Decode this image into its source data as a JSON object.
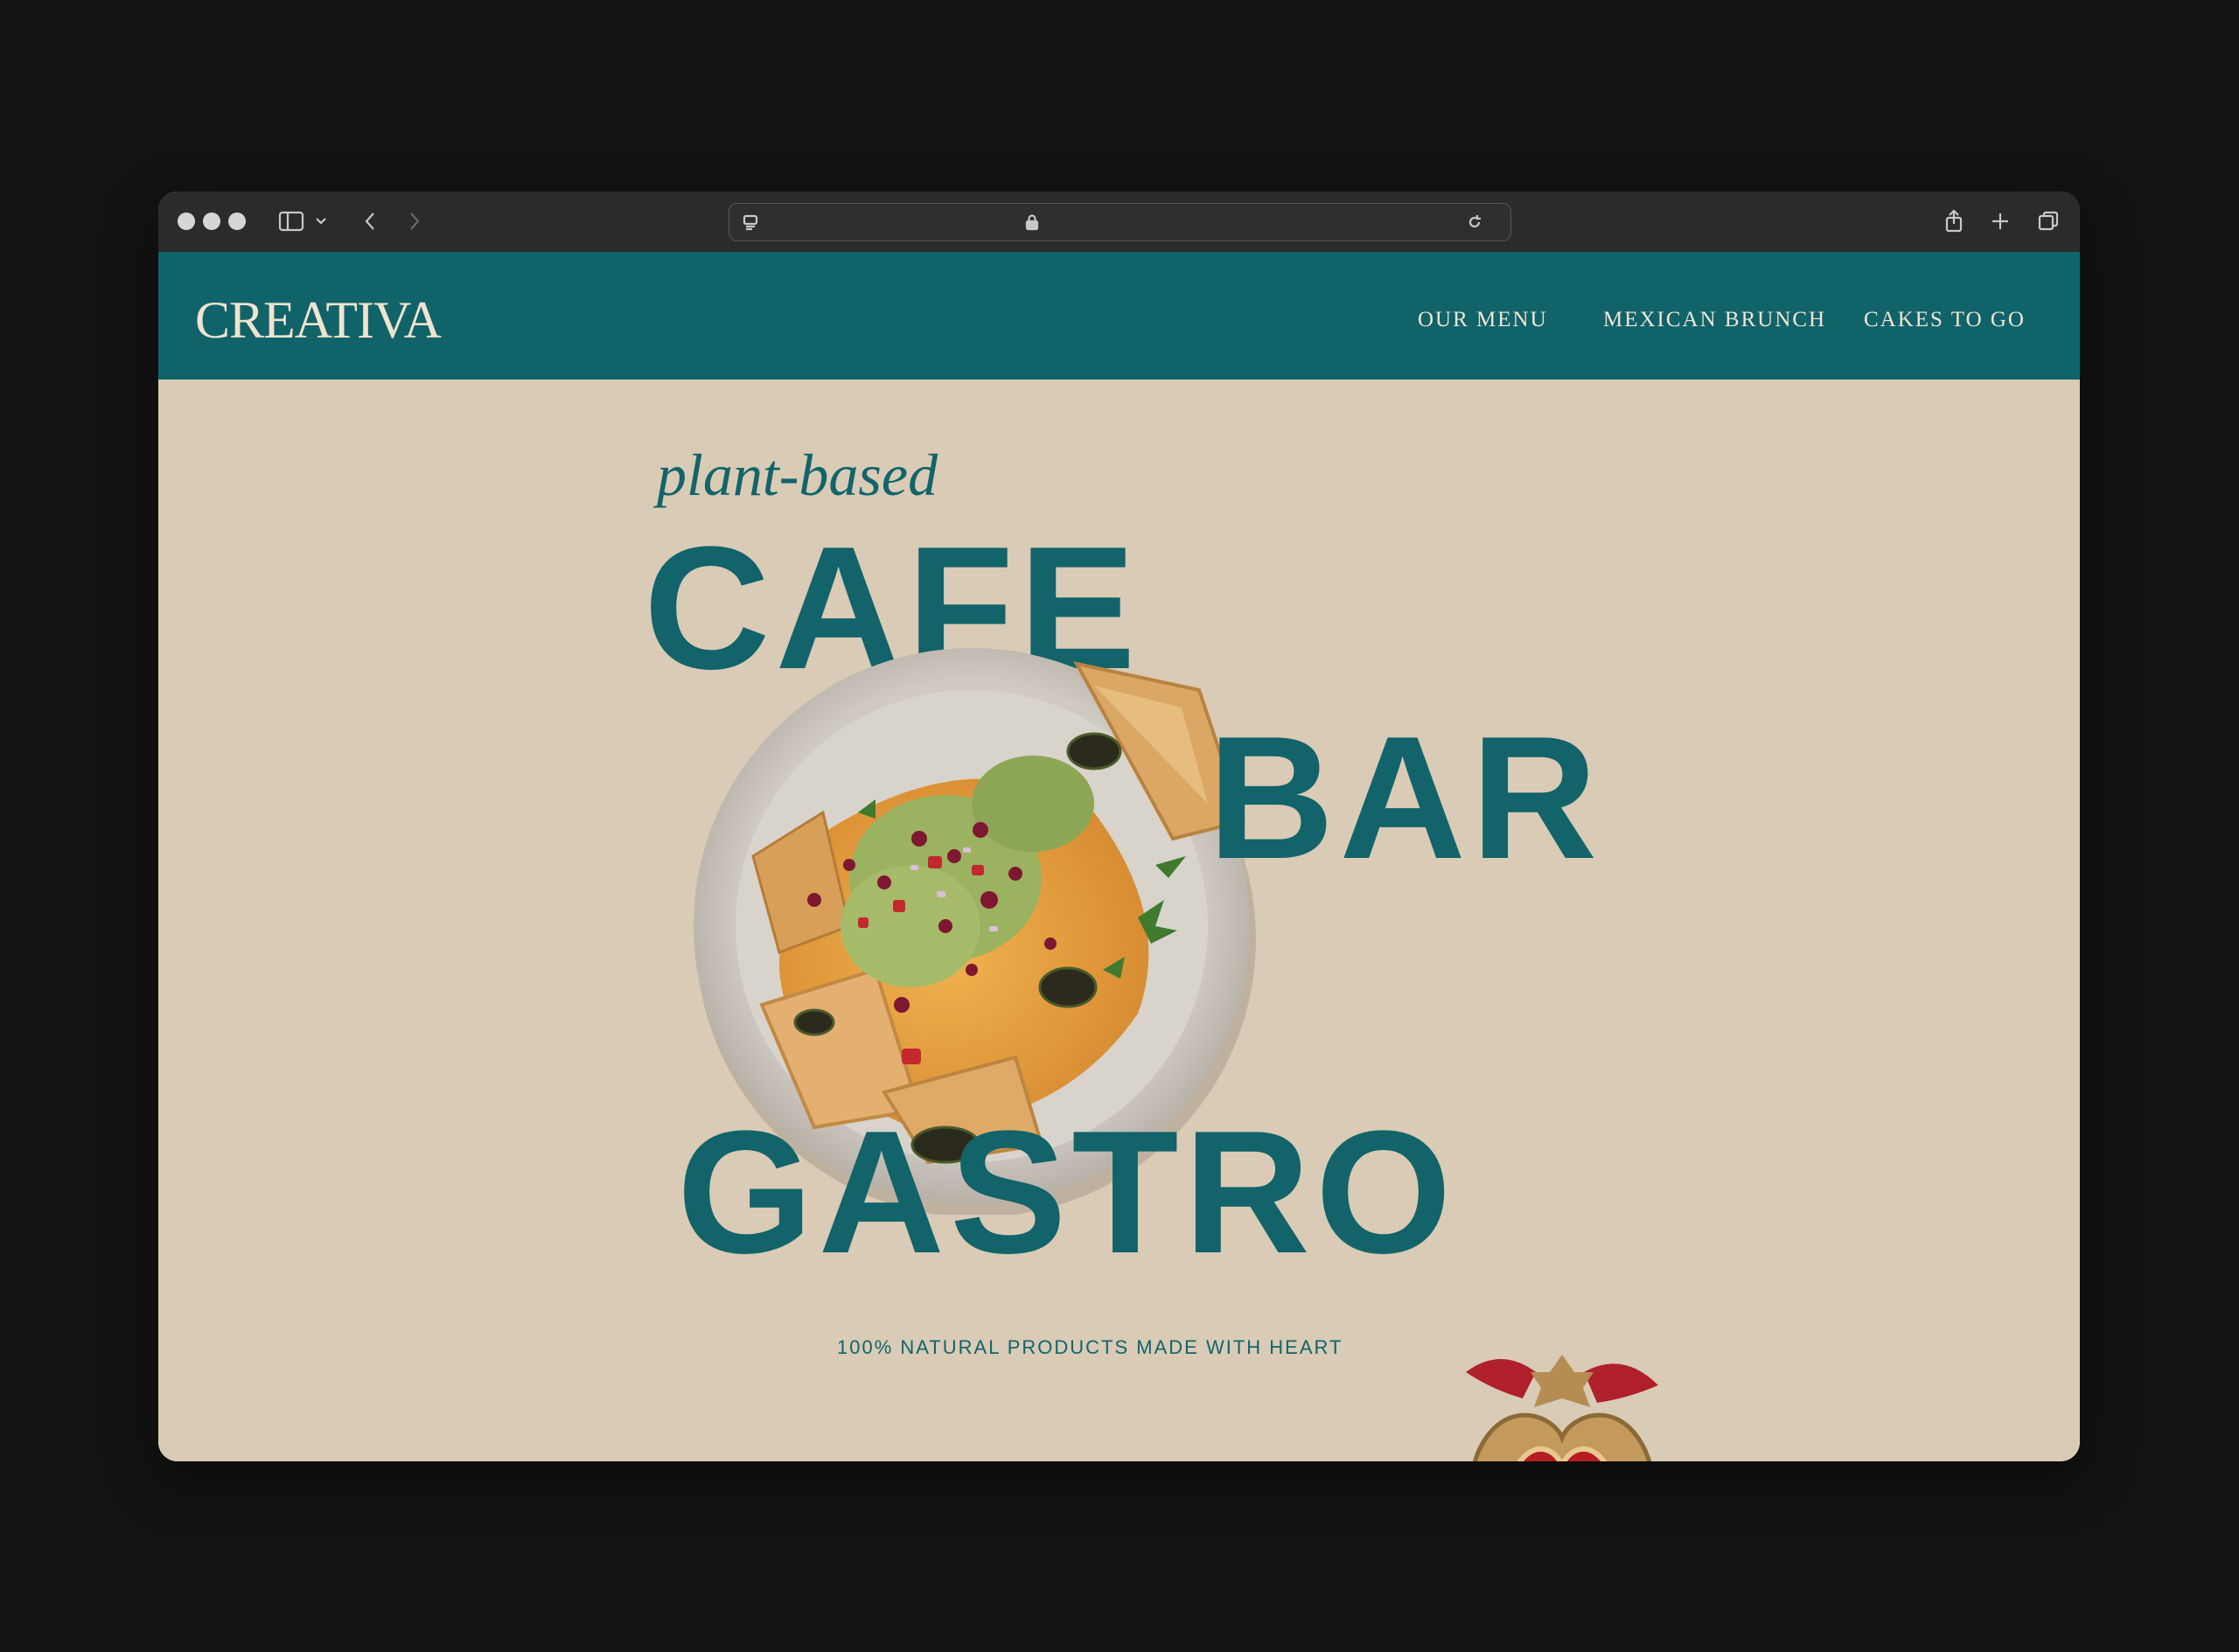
{
  "browser": {
    "window_controls": [
      "close",
      "minimize",
      "zoom"
    ],
    "icons": [
      "sidebar-icon",
      "chevron-down-icon",
      "back-icon",
      "forward-icon",
      "reader-icon",
      "lock-icon",
      "reload-icon",
      "share-icon",
      "new-tab-icon",
      "tabs-overview-icon"
    ]
  },
  "site": {
    "logo": "CREATIVA",
    "nav": [
      {
        "label": "OUR MENU"
      },
      {
        "label": "MEXICAN BRUNCH"
      },
      {
        "label": "CAKES TO GO"
      }
    ]
  },
  "hero": {
    "script_word": "plant-based",
    "word1": "CAFE",
    "word2": "BAR",
    "word3": "GASTRO",
    "tagline": "100% NATURAL PRODUCTS MADE WITH HEART"
  },
  "colors": {
    "brand_teal": "#11636a",
    "background_beige": "#d9cbb5",
    "heart_red": "#b51f23"
  }
}
